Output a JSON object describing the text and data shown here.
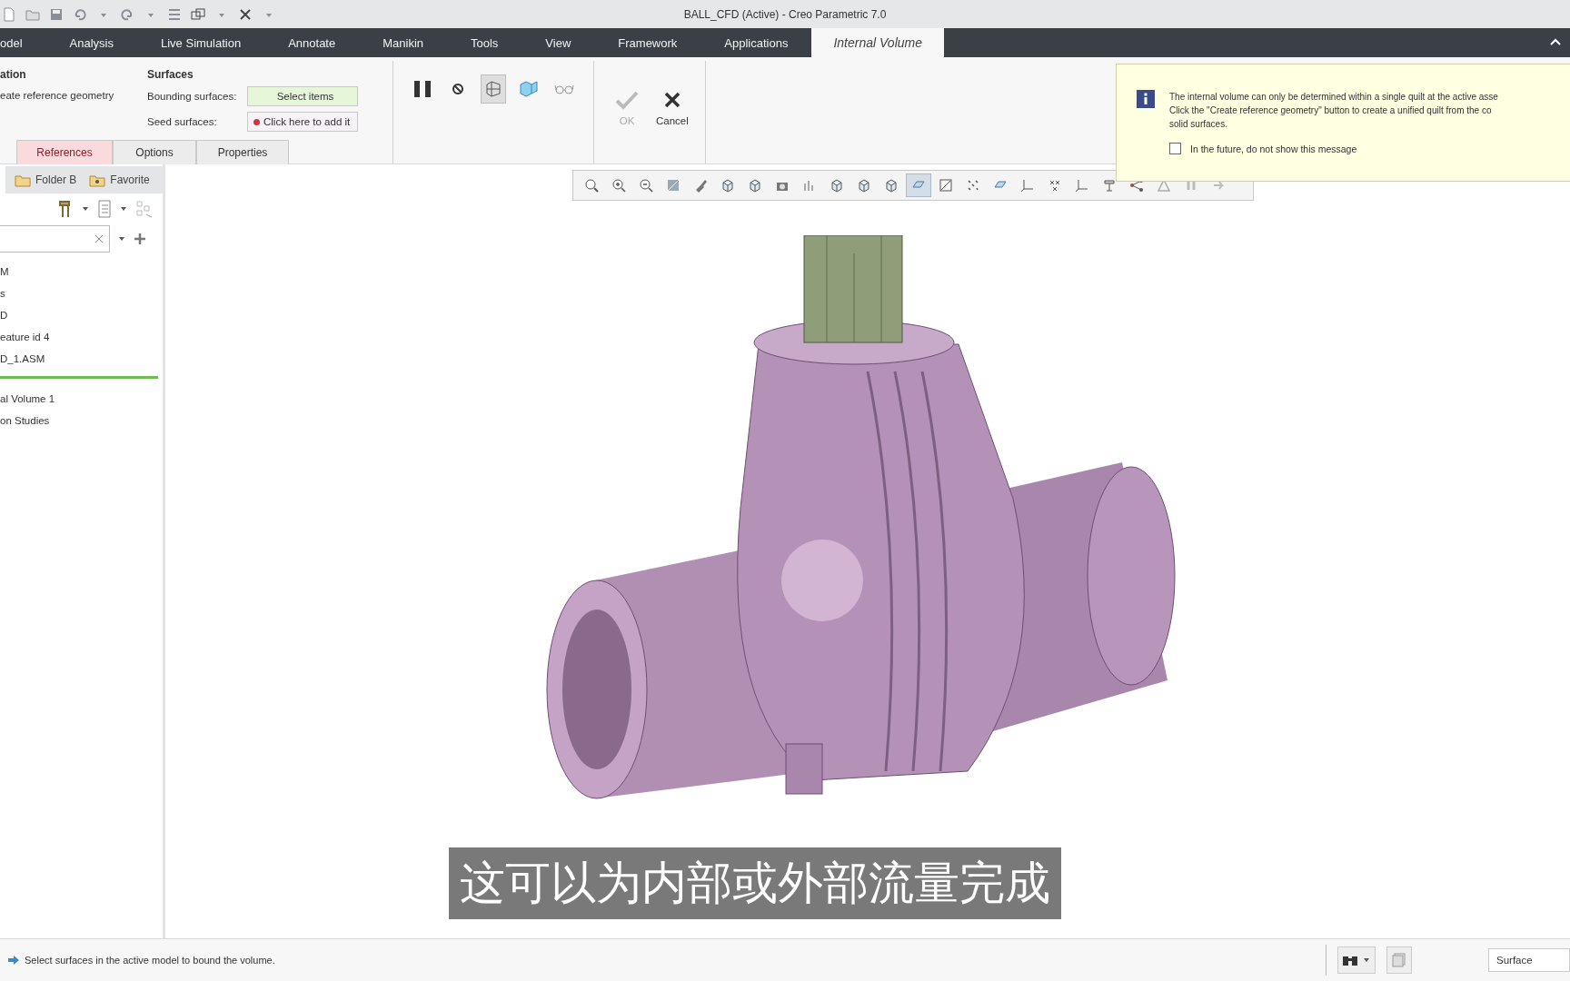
{
  "window": {
    "title": "BALL_CFD (Active) - Creo Parametric 7.0"
  },
  "tabs": [
    {
      "label": "odel",
      "selected": false
    },
    {
      "label": "Analysis",
      "selected": false
    },
    {
      "label": "Live Simulation",
      "selected": false
    },
    {
      "label": "Annotate",
      "selected": false
    },
    {
      "label": "Manikin",
      "selected": false
    },
    {
      "label": "Tools",
      "selected": false
    },
    {
      "label": "View",
      "selected": false
    },
    {
      "label": "Framework",
      "selected": false
    },
    {
      "label": "Applications",
      "selected": false
    },
    {
      "label": "Internal Volume",
      "selected": true
    }
  ],
  "ribbon": {
    "creation_group": {
      "title": "ation",
      "link": "eate reference geometry"
    },
    "surfaces_group": {
      "title": "Surfaces",
      "fields": [
        {
          "label": "Bounding surfaces:",
          "value": "Select items",
          "kind": "active"
        },
        {
          "label": "Seed surfaces:",
          "value": "Click here to add it",
          "kind": "missing"
        }
      ]
    },
    "tools": [
      {
        "kind": "pause",
        "selected": false
      },
      {
        "kind": "stop",
        "selected": false
      },
      {
        "kind": "preview",
        "selected": true
      },
      {
        "kind": "verify",
        "selected": false
      },
      {
        "kind": "glasses",
        "selected": false
      }
    ],
    "ok": {
      "label": "OK",
      "disabled": true
    },
    "cancel": {
      "label": "Cancel",
      "disabled": false
    }
  },
  "dialog_tabs": [
    {
      "label": "References",
      "selected": true
    },
    {
      "label": "Options",
      "selected": false
    },
    {
      "label": "Properties",
      "selected": false
    }
  ],
  "navigator": {
    "tabs": [
      {
        "label": "Folder B"
      },
      {
        "label": "Favorite"
      }
    ],
    "tree": [
      {
        "label": "M"
      },
      {
        "label": "s"
      },
      {
        "label": "D"
      },
      {
        "label": "eature id 4"
      },
      {
        "label": "D_1.ASM"
      },
      {
        "kind": "insert_line"
      },
      {
        "label": "al Volume 1"
      },
      {
        "label": "on Studies"
      }
    ]
  },
  "graphics_toolbar": [
    {
      "selected": false
    },
    {
      "selected": false
    },
    {
      "selected": false
    },
    {
      "selected": false
    },
    {
      "selected": false
    },
    {
      "selected": false
    },
    {
      "selected": false
    },
    {
      "selected": false
    },
    {
      "selected": false
    },
    {
      "selected": false
    },
    {
      "selected": false
    },
    {
      "selected": false
    },
    {
      "selected": true
    },
    {
      "selected": false
    },
    {
      "selected": false
    },
    {
      "selected": false
    },
    {
      "selected": false
    },
    {
      "selected": false
    },
    {
      "selected": false
    },
    {
      "selected": false
    },
    {
      "selected": false
    },
    {
      "selected": false
    },
    {
      "selected": false
    },
    {
      "selected": false
    }
  ],
  "message": {
    "lines": [
      "The internal volume can only be determined within a single quilt at the active asse",
      "Click the \"Create reference geometry\" button to create a unified quilt from the co",
      "solid surfaces."
    ],
    "checkbox": {
      "label": "In the future, do not show this message",
      "checked": false
    }
  },
  "subtitle": "这可以为内部或外部流量完成",
  "status_bar": {
    "message": "Select surfaces in the active model to bound the volume.",
    "filter": "Surface"
  }
}
